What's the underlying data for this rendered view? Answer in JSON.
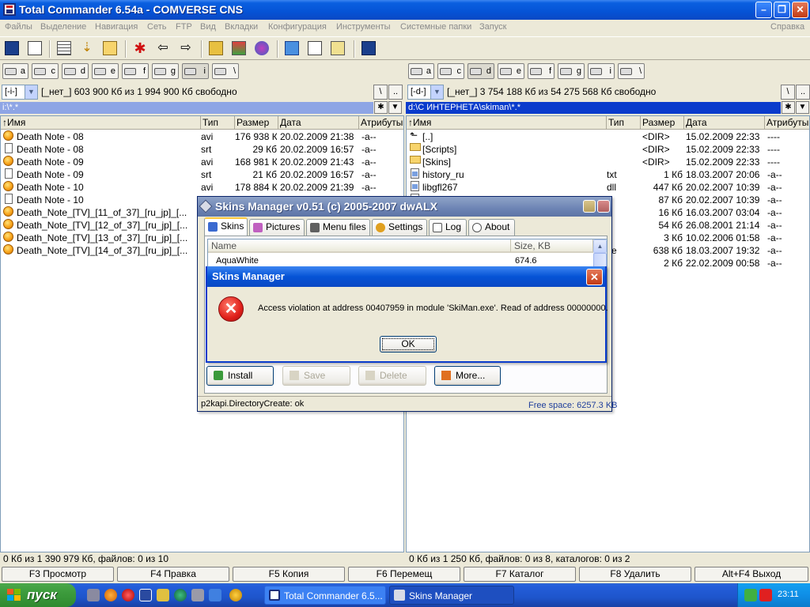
{
  "tc": {
    "title": "Total Commander 6.54a - COMVERSE CNS",
    "menu": [
      "Файлы",
      "Выделение",
      "Навигация",
      "Сеть",
      "FTP",
      "Вид",
      "Вкладки",
      "Конфигурация",
      "Инструменты",
      "Системные папки",
      "Запуск"
    ],
    "menu_help": "Справка",
    "left": {
      "drives": [
        "a",
        "c",
        "d",
        "e",
        "f",
        "g",
        "i",
        "\\"
      ],
      "drive_combo": "[-i-]",
      "free": "[_нет_]  603 900 Кб из 1 994 900 Кб свободно",
      "path": "i:\\*.*",
      "headers": [
        "↑Имя",
        "Тип",
        "Размер",
        "Дата",
        "Атрибуты"
      ],
      "rows": [
        {
          "icon": "avi",
          "name": "Death Note - 08",
          "ext": "avi",
          "size": "176 938 Кб",
          "date": "20.02.2009 21:38",
          "attr": "-a--"
        },
        {
          "icon": "srt",
          "name": "Death Note - 08",
          "ext": "srt",
          "size": "29 Кб",
          "date": "20.02.2009 16:57",
          "attr": "-a--"
        },
        {
          "icon": "avi",
          "name": "Death Note - 09",
          "ext": "avi",
          "size": "168 981 Кб",
          "date": "20.02.2009 21:43",
          "attr": "-a--"
        },
        {
          "icon": "srt",
          "name": "Death Note - 09",
          "ext": "srt",
          "size": "21 Кб",
          "date": "20.02.2009 16:57",
          "attr": "-a--"
        },
        {
          "icon": "avi",
          "name": "Death Note - 10",
          "ext": "avi",
          "size": "178 884 Кб",
          "date": "20.02.2009 21:39",
          "attr": "-a--"
        },
        {
          "icon": "srt",
          "name": "Death Note - 10",
          "ext": "",
          "size": "",
          "date": "",
          "attr": ""
        },
        {
          "icon": "avi",
          "name": "Death_Note_[TV]_[11_of_37]_[ru_jp]_[...",
          "ext": "",
          "size": "",
          "date": "",
          "attr": ""
        },
        {
          "icon": "avi",
          "name": "Death_Note_[TV]_[12_of_37]_[ru_jp]_[...",
          "ext": "",
          "size": "",
          "date": "",
          "attr": ""
        },
        {
          "icon": "avi",
          "name": "Death_Note_[TV]_[13_of_37]_[ru_jp]_[...",
          "ext": "",
          "size": "",
          "date": "",
          "attr": ""
        },
        {
          "icon": "avi",
          "name": "Death_Note_[TV]_[14_of_37]_[ru_jp]_[...",
          "ext": "",
          "size": "",
          "date": "",
          "attr": ""
        }
      ],
      "status": "0 Кб из 1 390 979 Кб, файлов: 0 из 10"
    },
    "right": {
      "drives": [
        "a",
        "c",
        "d",
        "e",
        "f",
        "g",
        "i",
        "\\"
      ],
      "drive_combo": "[-d-]",
      "free": "[_нет_]  3 754 188 Кб из 54 275 568 Кб свободно",
      "path": "d:\\С ИНТЕРНЕТА\\skiman\\*.*",
      "headers": [
        "↑Имя",
        "Тип",
        "Размер",
        "Дата",
        "Атрибуты"
      ],
      "rows": [
        {
          "icon": "up",
          "name": "[..]",
          "ext": "",
          "size": "<DIR>",
          "date": "15.02.2009 22:33",
          "attr": "----"
        },
        {
          "icon": "folder",
          "name": "[Scripts]",
          "ext": "",
          "size": "<DIR>",
          "date": "15.02.2009 22:33",
          "attr": "----"
        },
        {
          "icon": "folder",
          "name": "[Skins]",
          "ext": "",
          "size": "<DIR>",
          "date": "15.02.2009 22:33",
          "attr": "----"
        },
        {
          "icon": "file",
          "name": "history_ru",
          "ext": "txt",
          "size": "1 Кб",
          "date": "18.03.2007 20:06",
          "attr": "-a--"
        },
        {
          "icon": "file",
          "name": "libgfl267",
          "ext": "dll",
          "size": "447 Кб",
          "date": "20.02.2007 10:39",
          "attr": "-a--"
        },
        {
          "icon": "file",
          "name": "",
          "ext": "ll",
          "size": "87 Кб",
          "date": "20.02.2007 10:39",
          "attr": "-a--"
        },
        {
          "icon": "file",
          "name": "",
          "ext": "",
          "size": "16 Кб",
          "date": "16.03.2007 03:04",
          "attr": "-a--"
        },
        {
          "icon": "file",
          "name": "",
          "ext": "",
          "size": "54 Кб",
          "date": "26.08.2001 21:14",
          "attr": "-a--"
        },
        {
          "icon": "file",
          "name": "",
          "ext": "t",
          "size": "3 Кб",
          "date": "10.02.2006 01:58",
          "attr": "-a--"
        },
        {
          "icon": "file",
          "name": "",
          "ext": "xe",
          "size": "638 Кб",
          "date": "18.03.2007 19:32",
          "attr": "-a--"
        },
        {
          "icon": "file",
          "name": "",
          "ext": "i",
          "size": "2 Кб",
          "date": "22.02.2009 00:58",
          "attr": "-a--"
        }
      ],
      "status": "0 Кб из 1 250 Кб, файлов: 0 из 8, каталогов: 0 из 2"
    },
    "fkeys": [
      "F3 Просмотр",
      "F4 Правка",
      "F5 Копия",
      "F6 Перемещ",
      "F7 Каталог",
      "F8 Удалить",
      "Alt+F4 Выход"
    ]
  },
  "skins_manager": {
    "title": "Skins Manager v0.51 (c) 2005-2007 dwALX",
    "tabs": [
      "Skins",
      "Pictures",
      "Menu files",
      "Settings",
      "Log",
      "About"
    ],
    "list_headers": [
      "Name",
      "Size, KB"
    ],
    "list_rows": [
      {
        "name": "AquaWhite",
        "size": "674.6"
      }
    ],
    "buttons": {
      "install": "Install",
      "save": "Save",
      "delete": "Delete",
      "more": "More..."
    },
    "free_space": "Free space: 6257.3 KB",
    "status": "p2kapi.DirectoryCreate: ok"
  },
  "error_dialog": {
    "title": "Skins Manager",
    "message": "Access violation at address 00407959 in module 'SkiMan.exe'. Read of address 00000000.",
    "ok": "OK"
  },
  "taskbar": {
    "start": "пуск",
    "tasks": [
      "Total Commander 6.5...",
      "Skins Manager"
    ],
    "clock": "23:11"
  }
}
